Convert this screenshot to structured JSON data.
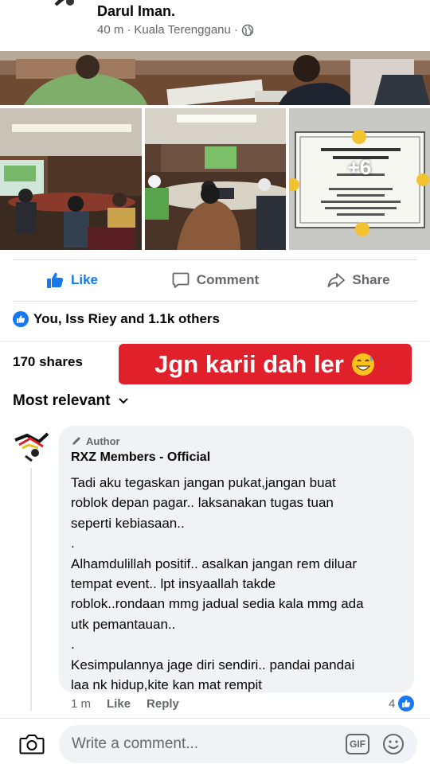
{
  "post": {
    "page_name": "Darul Iman.",
    "time": "40 m",
    "location": "Kuala Terengganu",
    "separator": "·",
    "more_photos": "+6"
  },
  "actions": {
    "like": "Like",
    "comment": "Comment",
    "share": "Share"
  },
  "reactions": {
    "summary": "You, Iss Riey and 1.1k others"
  },
  "shares": "170 shares",
  "banner": {
    "text": "Jgn karii dah ler"
  },
  "sort": {
    "label": "Most relevant"
  },
  "comment": {
    "author_badge": "Author",
    "name": "RXZ Members - Official",
    "text": "Tadi aku tegaskan jangan pukat,jangan buat\nroblok depan pagar.. laksanakan tugas tuan\nseperti kebiasaan..\n.\nAlhamdulillah positif.. asalkan jangan rem diluar\ntempat event.. lpt insyaallah takde\nroblok..rondaan mmg jadual sedia kala mmg ada\nutk pemantauan..\n.\nKesimpulannya jage diri sendiri.. pandai pandai\nlaa nk hidup,kite kan mat rempit",
    "time": "1 m",
    "like": "Like",
    "reply": "Reply",
    "like_count": "4"
  },
  "composer": {
    "placeholder": "Write a comment...",
    "gif": "GIF"
  },
  "colors": {
    "brand_blue": "#1877f2",
    "banner_red": "#e0202a",
    "secondary_text": "#65676b",
    "bubble_bg": "#f0f2f5"
  },
  "icons": [
    "globe-icon",
    "like-thumb-icon",
    "comment-icon",
    "share-icon",
    "like-badge-icon",
    "grin-sweat-emoji",
    "chevron-down-icon",
    "pencil-icon",
    "camera-icon",
    "gif-icon",
    "smiley-icon"
  ]
}
